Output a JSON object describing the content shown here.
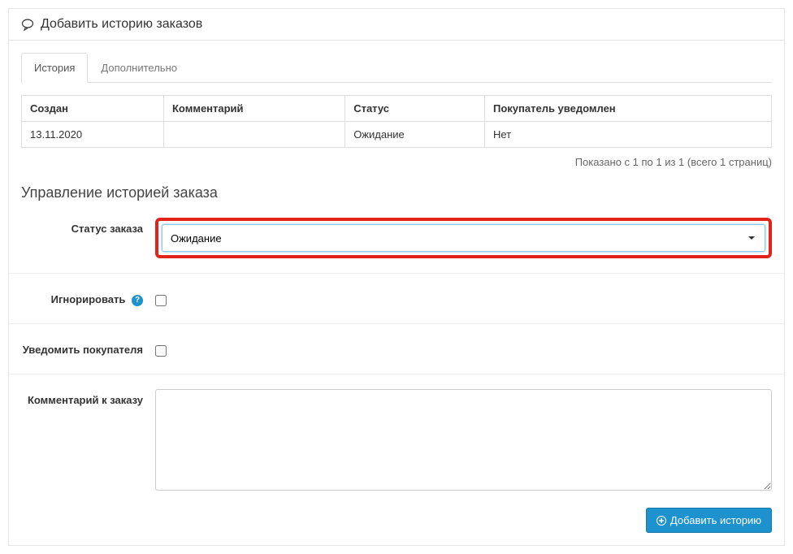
{
  "header": {
    "title": "Добавить историю заказов"
  },
  "tabs": [
    {
      "label": "История",
      "active": true
    },
    {
      "label": "Дополнительно",
      "active": false
    }
  ],
  "history_table": {
    "headers": {
      "created": "Создан",
      "comment": "Комментарий",
      "status": "Статус",
      "notified": "Покупатель уведомлен"
    },
    "rows": [
      {
        "created": "13.11.2020",
        "comment": "",
        "status": "Ожидание",
        "notified": "Нет"
      }
    ]
  },
  "pagination_text": "Показано с 1 по 1 из 1 (всего 1 страниц)",
  "section_title": "Управление историей заказа",
  "form": {
    "status_label": "Статус заказа",
    "status_value": "Ожидание",
    "override_label": "Игнорировать",
    "notify_label": "Уведомить покупателя",
    "comment_label": "Комментарий к заказу"
  },
  "buttons": {
    "add_history": "Добавить историю"
  }
}
